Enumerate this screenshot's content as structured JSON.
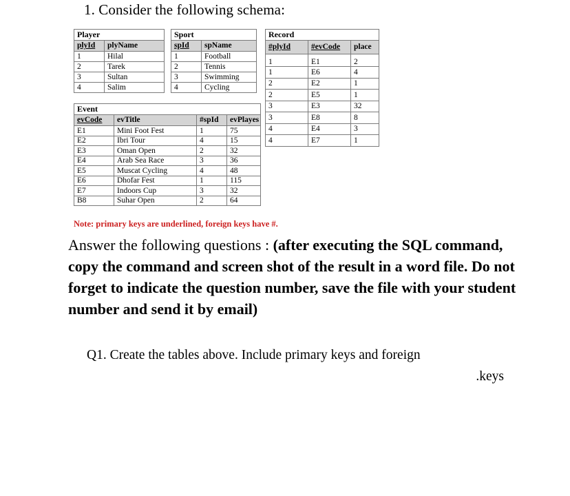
{
  "heading": "1. Consider the following schema:",
  "tables": {
    "player": {
      "title": "Player",
      "columns": [
        {
          "label": "plyId",
          "key": "pk"
        },
        {
          "label": "plyName",
          "key": ""
        }
      ],
      "rows": [
        [
          "1",
          "Hilal"
        ],
        [
          "2",
          "Tarek"
        ],
        [
          "3",
          "Sultan"
        ],
        [
          "4",
          "Salim"
        ]
      ]
    },
    "sport": {
      "title": "Sport",
      "columns": [
        {
          "label": "spId",
          "key": "pk"
        },
        {
          "label": "spName",
          "key": ""
        }
      ],
      "rows": [
        [
          "1",
          "Football"
        ],
        [
          "2",
          "Tennis"
        ],
        [
          "3",
          "Swimming"
        ],
        [
          "4",
          "Cycling"
        ]
      ]
    },
    "record": {
      "title": "Record",
      "columns": [
        {
          "label": "#plyId",
          "key": "pk"
        },
        {
          "label": "#evCode",
          "key": "pk"
        },
        {
          "label": "place",
          "key": ""
        }
      ],
      "rows": [
        [
          "1",
          "E1",
          "2"
        ],
        [
          "1",
          "E6",
          "4"
        ],
        [
          "2",
          "E2",
          "1"
        ],
        [
          "2",
          "E5",
          "1"
        ],
        [
          "3",
          "E3",
          "32"
        ],
        [
          "3",
          "E8",
          "8"
        ],
        [
          "4",
          "E4",
          "3"
        ],
        [
          "4",
          "E7",
          "1"
        ]
      ]
    },
    "event": {
      "title": "Event",
      "columns": [
        {
          "label": "evCode",
          "key": "pk"
        },
        {
          "label": "evTitle",
          "key": ""
        },
        {
          "label": "#spId",
          "key": ""
        },
        {
          "label": "evPlayes",
          "key": ""
        }
      ],
      "rows": [
        [
          "E1",
          "Mini Foot Fest",
          "1",
          "75"
        ],
        [
          "E2",
          "Ibri Tour",
          "4",
          "15"
        ],
        [
          "E3",
          "Oman Open",
          "2",
          "32"
        ],
        [
          "E4",
          "Arab Sea Race",
          "3",
          "36"
        ],
        [
          "E5",
          "Muscat Cycling",
          "4",
          "48"
        ],
        [
          "E6",
          "Dhofar Fest",
          "1",
          "115"
        ],
        [
          "E7",
          "Indoors Cup",
          "3",
          "32"
        ],
        [
          "B8",
          "Suhar Open",
          "2",
          "64"
        ]
      ]
    }
  },
  "note": {
    "text": "Note: primary keys are underlined, foreign keys have #.",
    "color": "#cc2222"
  },
  "answer": {
    "lead": "Answer the following questions : ",
    "emphasis": "(after executing the SQL command, copy the command and screen shot of the result in a word file. Do not forget to indicate the question number, save the file with your student number and send it by email)"
  },
  "question1": {
    "line1": "Q1. Create the tables above. Include primary keys and foreign",
    "line2": ".keys"
  }
}
